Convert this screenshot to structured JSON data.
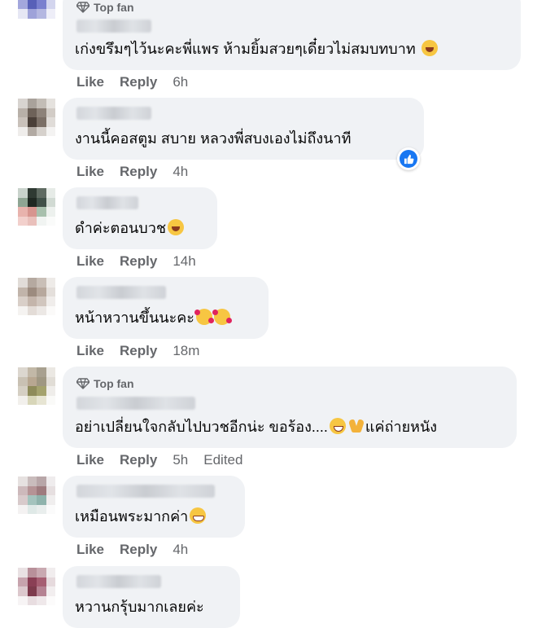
{
  "labels": {
    "like": "Like",
    "reply": "Reply"
  },
  "comments": [
    {
      "top_fan": "Top fan",
      "text": "เก่งขรึมๆไว้นะคะพี่แพร ห้ามยิ้มสวยๆเดี๋ยวไม่สมบทบาท",
      "emojis": [
        "laugh"
      ],
      "time": "6h",
      "edited": ""
    },
    {
      "top_fan": "",
      "text": "งานนี้คอสตูม สบาย หลวงพี่สบงเองไม่ถึงนาที",
      "emojis": [],
      "time": "4h",
      "edited": "",
      "reaction": "like"
    },
    {
      "top_fan": "",
      "text": "ดำค่ะตอนบวช",
      "emojis": [
        "laugh"
      ],
      "time": "14h",
      "edited": ""
    },
    {
      "top_fan": "",
      "text": "หน้าหวานขึ้นนะคะ",
      "emojis": [
        "hearts",
        "hearts"
      ],
      "time": "18m",
      "edited": ""
    },
    {
      "top_fan": "Top fan",
      "text": "อย่าเปลี่ยนใจกลับไปบวชอีกน่ะ ขอร้อง....",
      "text_after": "แค่ถ่ายหนัง",
      "emojis": [
        "sweat",
        "pray"
      ],
      "time": "5h",
      "edited": "Edited"
    },
    {
      "top_fan": "",
      "text": "เหมือนพระมากค่า",
      "emojis": [
        "grin"
      ],
      "time": "4h",
      "edited": ""
    },
    {
      "top_fan": "",
      "text": "หวานกรุ้บมากเลยค่ะ",
      "emojis": [],
      "time": "",
      "edited": ""
    }
  ],
  "colors": {
    "bubble": "#f0f2f5",
    "secondary_text": "#65676b",
    "like_blue": "#1877f2"
  }
}
